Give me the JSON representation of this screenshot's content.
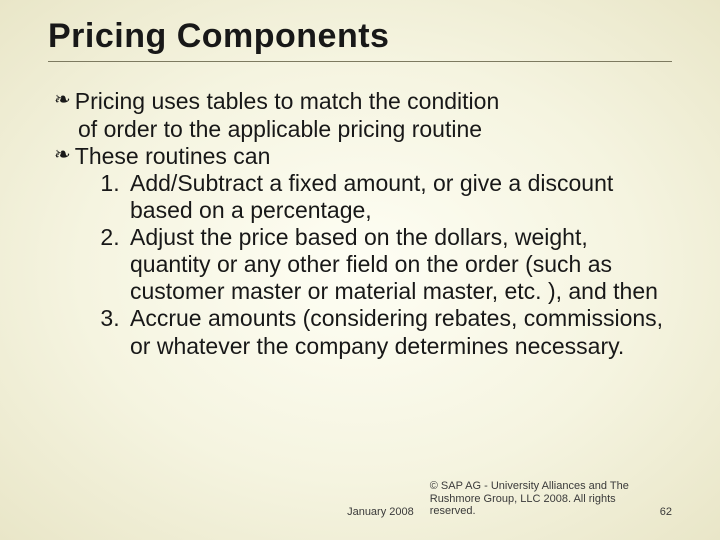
{
  "title": "Pricing Components",
  "bullets": {
    "b1_lead": "Pricing",
    "b1_rest": " uses tables to match the condition",
    "b1_cont": "of order to the applicable pricing routine",
    "b2_lead": "These",
    "b2_rest": " routines can"
  },
  "numbered": {
    "n1": "Add/Subtract a fixed amount, or give a discount based on a percentage,",
    "n2": "Adjust the price based on the dollars, weight, quantity or any other field on the order (such as customer master or material master, etc. ), and then",
    "n3": "Accrue amounts (considering rebates, commissions, or whatever the company determines necessary."
  },
  "footer": {
    "date": "January 2008",
    "copyright": "© SAP AG - University Alliances and The Rushmore Group, LLC 2008. All rights reserved.",
    "page": "62"
  }
}
